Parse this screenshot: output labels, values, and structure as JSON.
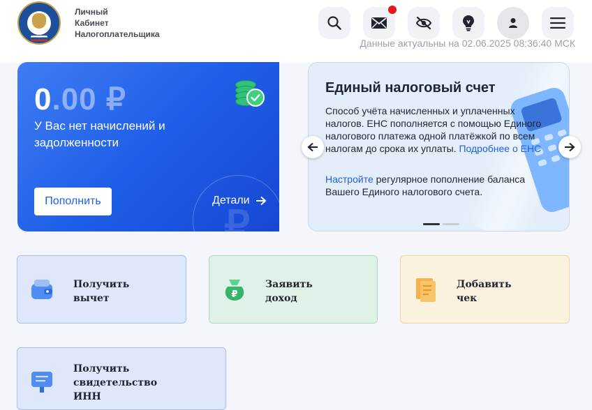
{
  "brand": {
    "lines": [
      "Личный",
      "Кабинет",
      "Налогоплательщика"
    ]
  },
  "header": {
    "updated": "Данные актуальны на 02.06.2025 08:36:40 МСК",
    "icons": [
      "search-icon",
      "mail-icon",
      "eye-off-icon",
      "lightbulb-icon",
      "user-icon",
      "menu-icon"
    ],
    "has_notification": true
  },
  "balance": {
    "integer": "0",
    "decimal": ".00 ₽",
    "message": "У Вас нет начислений и задолженности",
    "topup_label": "Пополнить",
    "details_label": "Детали"
  },
  "info_card": {
    "title": "Единый налоговый счет",
    "description": "Способ учёта начисленных и уплаченных налогов. ЕНС пополняется с помощью Единого налогового платежа одной платёжкой по всем налогам до срока их уплаты.",
    "more_link": "Подробнее о ЕНС",
    "setup_link": "Настройте",
    "setup_rest": "регулярное пополнение баланса Вашего Единого налогового счета.",
    "slides_total": 2,
    "slide_active": 1
  },
  "tiles": [
    {
      "line1": "Получить",
      "line2": "вычет"
    },
    {
      "line1": "Заявить",
      "line2": "доход"
    },
    {
      "line1": "Добавить",
      "line2": "чек"
    },
    {
      "line1": "Получить",
      "line2": "свидетельство",
      "line3": "ИНН"
    }
  ],
  "colors": {
    "accent_blue": "#1f5fe8",
    "notification_red": "#e8171c",
    "tile_blue_bg": "#dfe8fb",
    "tile_green_bg": "#e0f2e8",
    "tile_orange_bg": "#fbf1df"
  }
}
